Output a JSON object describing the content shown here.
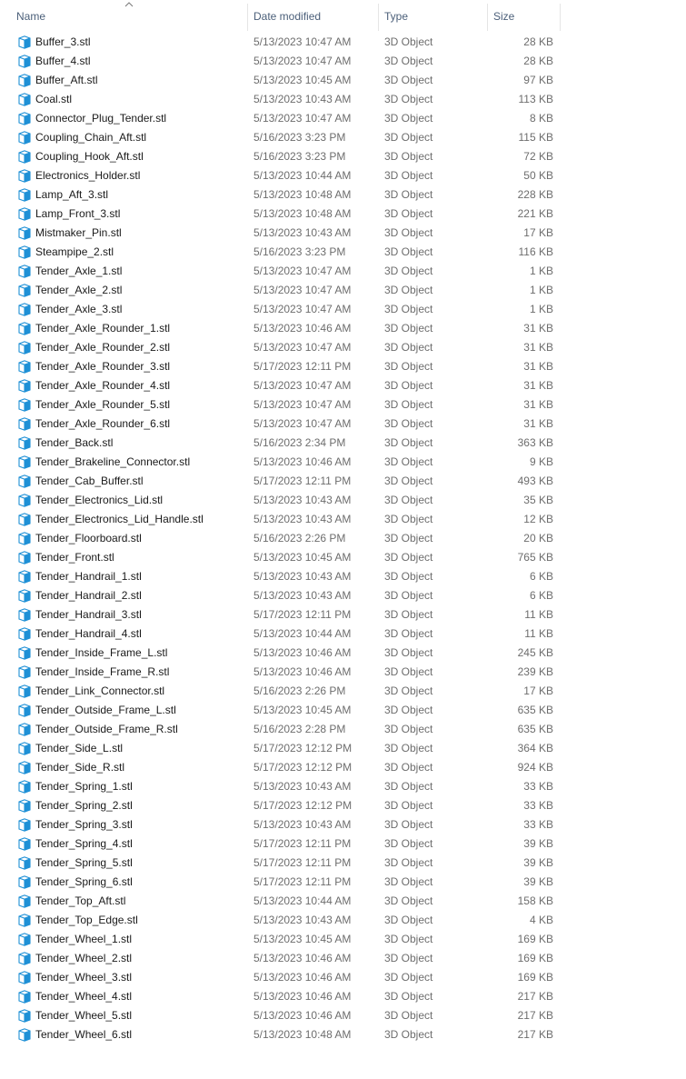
{
  "columns": {
    "name": "Name",
    "date_modified": "Date modified",
    "type": "Type",
    "size": "Size"
  },
  "sort": {
    "column": "name",
    "direction": "ascending"
  },
  "icon": {
    "name": "3d-object-file-icon",
    "color": "#1e90d6"
  },
  "files": [
    {
      "name": "Buffer_3.stl",
      "date": "5/13/2023 10:47 AM",
      "type": "3D Object",
      "size": "28 KB"
    },
    {
      "name": "Buffer_4.stl",
      "date": "5/13/2023 10:47 AM",
      "type": "3D Object",
      "size": "28 KB"
    },
    {
      "name": "Buffer_Aft.stl",
      "date": "5/13/2023 10:45 AM",
      "type": "3D Object",
      "size": "97 KB"
    },
    {
      "name": "Coal.stl",
      "date": "5/13/2023 10:43 AM",
      "type": "3D Object",
      "size": "113 KB"
    },
    {
      "name": "Connector_Plug_Tender.stl",
      "date": "5/13/2023 10:47 AM",
      "type": "3D Object",
      "size": "8 KB"
    },
    {
      "name": "Coupling_Chain_Aft.stl",
      "date": "5/16/2023 3:23 PM",
      "type": "3D Object",
      "size": "115 KB"
    },
    {
      "name": "Coupling_Hook_Aft.stl",
      "date": "5/16/2023 3:23 PM",
      "type": "3D Object",
      "size": "72 KB"
    },
    {
      "name": "Electronics_Holder.stl",
      "date": "5/13/2023 10:44 AM",
      "type": "3D Object",
      "size": "50 KB"
    },
    {
      "name": "Lamp_Aft_3.stl",
      "date": "5/13/2023 10:48 AM",
      "type": "3D Object",
      "size": "228 KB"
    },
    {
      "name": "Lamp_Front_3.stl",
      "date": "5/13/2023 10:48 AM",
      "type": "3D Object",
      "size": "221 KB"
    },
    {
      "name": "Mistmaker_Pin.stl",
      "date": "5/13/2023 10:43 AM",
      "type": "3D Object",
      "size": "17 KB"
    },
    {
      "name": "Steampipe_2.stl",
      "date": "5/16/2023 3:23 PM",
      "type": "3D Object",
      "size": "116 KB"
    },
    {
      "name": "Tender_Axle_1.stl",
      "date": "5/13/2023 10:47 AM",
      "type": "3D Object",
      "size": "1 KB"
    },
    {
      "name": "Tender_Axle_2.stl",
      "date": "5/13/2023 10:47 AM",
      "type": "3D Object",
      "size": "1 KB"
    },
    {
      "name": "Tender_Axle_3.stl",
      "date": "5/13/2023 10:47 AM",
      "type": "3D Object",
      "size": "1 KB"
    },
    {
      "name": "Tender_Axle_Rounder_1.stl",
      "date": "5/13/2023 10:46 AM",
      "type": "3D Object",
      "size": "31 KB"
    },
    {
      "name": "Tender_Axle_Rounder_2.stl",
      "date": "5/13/2023 10:47 AM",
      "type": "3D Object",
      "size": "31 KB"
    },
    {
      "name": "Tender_Axle_Rounder_3.stl",
      "date": "5/17/2023 12:11 PM",
      "type": "3D Object",
      "size": "31 KB"
    },
    {
      "name": "Tender_Axle_Rounder_4.stl",
      "date": "5/13/2023 10:47 AM",
      "type": "3D Object",
      "size": "31 KB"
    },
    {
      "name": "Tender_Axle_Rounder_5.stl",
      "date": "5/13/2023 10:47 AM",
      "type": "3D Object",
      "size": "31 KB"
    },
    {
      "name": "Tender_Axle_Rounder_6.stl",
      "date": "5/13/2023 10:47 AM",
      "type": "3D Object",
      "size": "31 KB"
    },
    {
      "name": "Tender_Back.stl",
      "date": "5/16/2023 2:34 PM",
      "type": "3D Object",
      "size": "363 KB"
    },
    {
      "name": "Tender_Brakeline_Connector.stl",
      "date": "5/13/2023 10:46 AM",
      "type": "3D Object",
      "size": "9 KB"
    },
    {
      "name": "Tender_Cab_Buffer.stl",
      "date": "5/17/2023 12:11 PM",
      "type": "3D Object",
      "size": "493 KB"
    },
    {
      "name": "Tender_Electronics_Lid.stl",
      "date": "5/13/2023 10:43 AM",
      "type": "3D Object",
      "size": "35 KB"
    },
    {
      "name": "Tender_Electronics_Lid_Handle.stl",
      "date": "5/13/2023 10:43 AM",
      "type": "3D Object",
      "size": "12 KB"
    },
    {
      "name": "Tender_Floorboard.stl",
      "date": "5/16/2023 2:26 PM",
      "type": "3D Object",
      "size": "20 KB"
    },
    {
      "name": "Tender_Front.stl",
      "date": "5/13/2023 10:45 AM",
      "type": "3D Object",
      "size": "765 KB"
    },
    {
      "name": "Tender_Handrail_1.stl",
      "date": "5/13/2023 10:43 AM",
      "type": "3D Object",
      "size": "6 KB"
    },
    {
      "name": "Tender_Handrail_2.stl",
      "date": "5/13/2023 10:43 AM",
      "type": "3D Object",
      "size": "6 KB"
    },
    {
      "name": "Tender_Handrail_3.stl",
      "date": "5/17/2023 12:11 PM",
      "type": "3D Object",
      "size": "11 KB"
    },
    {
      "name": "Tender_Handrail_4.stl",
      "date": "5/13/2023 10:44 AM",
      "type": "3D Object",
      "size": "11 KB"
    },
    {
      "name": "Tender_Inside_Frame_L.stl",
      "date": "5/13/2023 10:46 AM",
      "type": "3D Object",
      "size": "245 KB"
    },
    {
      "name": "Tender_Inside_Frame_R.stl",
      "date": "5/13/2023 10:46 AM",
      "type": "3D Object",
      "size": "239 KB"
    },
    {
      "name": "Tender_Link_Connector.stl",
      "date": "5/16/2023 2:26 PM",
      "type": "3D Object",
      "size": "17 KB"
    },
    {
      "name": "Tender_Outside_Frame_L.stl",
      "date": "5/13/2023 10:45 AM",
      "type": "3D Object",
      "size": "635 KB"
    },
    {
      "name": "Tender_Outside_Frame_R.stl",
      "date": "5/16/2023 2:28 PM",
      "type": "3D Object",
      "size": "635 KB"
    },
    {
      "name": "Tender_Side_L.stl",
      "date": "5/17/2023 12:12 PM",
      "type": "3D Object",
      "size": "364 KB"
    },
    {
      "name": "Tender_Side_R.stl",
      "date": "5/17/2023 12:12 PM",
      "type": "3D Object",
      "size": "924 KB"
    },
    {
      "name": "Tender_Spring_1.stl",
      "date": "5/13/2023 10:43 AM",
      "type": "3D Object",
      "size": "33 KB"
    },
    {
      "name": "Tender_Spring_2.stl",
      "date": "5/17/2023 12:12 PM",
      "type": "3D Object",
      "size": "33 KB"
    },
    {
      "name": "Tender_Spring_3.stl",
      "date": "5/13/2023 10:43 AM",
      "type": "3D Object",
      "size": "33 KB"
    },
    {
      "name": "Tender_Spring_4.stl",
      "date": "5/17/2023 12:11 PM",
      "type": "3D Object",
      "size": "39 KB"
    },
    {
      "name": "Tender_Spring_5.stl",
      "date": "5/17/2023 12:11 PM",
      "type": "3D Object",
      "size": "39 KB"
    },
    {
      "name": "Tender_Spring_6.stl",
      "date": "5/17/2023 12:11 PM",
      "type": "3D Object",
      "size": "39 KB"
    },
    {
      "name": "Tender_Top_Aft.stl",
      "date": "5/13/2023 10:44 AM",
      "type": "3D Object",
      "size": "158 KB"
    },
    {
      "name": "Tender_Top_Edge.stl",
      "date": "5/13/2023 10:43 AM",
      "type": "3D Object",
      "size": "4 KB"
    },
    {
      "name": "Tender_Wheel_1.stl",
      "date": "5/13/2023 10:45 AM",
      "type": "3D Object",
      "size": "169 KB"
    },
    {
      "name": "Tender_Wheel_2.stl",
      "date": "5/13/2023 10:46 AM",
      "type": "3D Object",
      "size": "169 KB"
    },
    {
      "name": "Tender_Wheel_3.stl",
      "date": "5/13/2023 10:46 AM",
      "type": "3D Object",
      "size": "169 KB"
    },
    {
      "name": "Tender_Wheel_4.stl",
      "date": "5/13/2023 10:46 AM",
      "type": "3D Object",
      "size": "217 KB"
    },
    {
      "name": "Tender_Wheel_5.stl",
      "date": "5/13/2023 10:46 AM",
      "type": "3D Object",
      "size": "217 KB"
    },
    {
      "name": "Tender_Wheel_6.stl",
      "date": "5/13/2023 10:48 AM",
      "type": "3D Object",
      "size": "217 KB"
    }
  ]
}
